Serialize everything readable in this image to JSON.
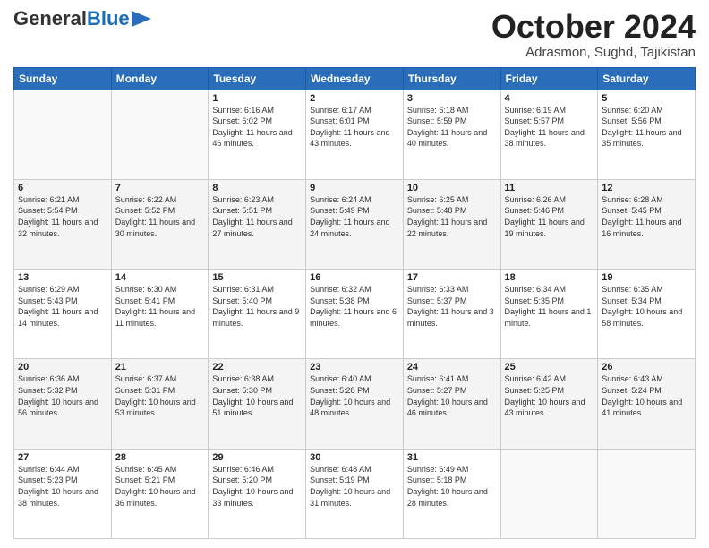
{
  "header": {
    "logo_general": "General",
    "logo_blue": "Blue",
    "month_title": "October 2024",
    "location": "Adrasmon, Sughd, Tajikistan"
  },
  "days_of_week": [
    "Sunday",
    "Monday",
    "Tuesday",
    "Wednesday",
    "Thursday",
    "Friday",
    "Saturday"
  ],
  "weeks": [
    [
      {
        "day": "",
        "sunrise": "",
        "sunset": "",
        "daylight": ""
      },
      {
        "day": "",
        "sunrise": "",
        "sunset": "",
        "daylight": ""
      },
      {
        "day": "1",
        "sunrise": "Sunrise: 6:16 AM",
        "sunset": "Sunset: 6:02 PM",
        "daylight": "Daylight: 11 hours and 46 minutes."
      },
      {
        "day": "2",
        "sunrise": "Sunrise: 6:17 AM",
        "sunset": "Sunset: 6:01 PM",
        "daylight": "Daylight: 11 hours and 43 minutes."
      },
      {
        "day": "3",
        "sunrise": "Sunrise: 6:18 AM",
        "sunset": "Sunset: 5:59 PM",
        "daylight": "Daylight: 11 hours and 40 minutes."
      },
      {
        "day": "4",
        "sunrise": "Sunrise: 6:19 AM",
        "sunset": "Sunset: 5:57 PM",
        "daylight": "Daylight: 11 hours and 38 minutes."
      },
      {
        "day": "5",
        "sunrise": "Sunrise: 6:20 AM",
        "sunset": "Sunset: 5:56 PM",
        "daylight": "Daylight: 11 hours and 35 minutes."
      }
    ],
    [
      {
        "day": "6",
        "sunrise": "Sunrise: 6:21 AM",
        "sunset": "Sunset: 5:54 PM",
        "daylight": "Daylight: 11 hours and 32 minutes."
      },
      {
        "day": "7",
        "sunrise": "Sunrise: 6:22 AM",
        "sunset": "Sunset: 5:52 PM",
        "daylight": "Daylight: 11 hours and 30 minutes."
      },
      {
        "day": "8",
        "sunrise": "Sunrise: 6:23 AM",
        "sunset": "Sunset: 5:51 PM",
        "daylight": "Daylight: 11 hours and 27 minutes."
      },
      {
        "day": "9",
        "sunrise": "Sunrise: 6:24 AM",
        "sunset": "Sunset: 5:49 PM",
        "daylight": "Daylight: 11 hours and 24 minutes."
      },
      {
        "day": "10",
        "sunrise": "Sunrise: 6:25 AM",
        "sunset": "Sunset: 5:48 PM",
        "daylight": "Daylight: 11 hours and 22 minutes."
      },
      {
        "day": "11",
        "sunrise": "Sunrise: 6:26 AM",
        "sunset": "Sunset: 5:46 PM",
        "daylight": "Daylight: 11 hours and 19 minutes."
      },
      {
        "day": "12",
        "sunrise": "Sunrise: 6:28 AM",
        "sunset": "Sunset: 5:45 PM",
        "daylight": "Daylight: 11 hours and 16 minutes."
      }
    ],
    [
      {
        "day": "13",
        "sunrise": "Sunrise: 6:29 AM",
        "sunset": "Sunset: 5:43 PM",
        "daylight": "Daylight: 11 hours and 14 minutes."
      },
      {
        "day": "14",
        "sunrise": "Sunrise: 6:30 AM",
        "sunset": "Sunset: 5:41 PM",
        "daylight": "Daylight: 11 hours and 11 minutes."
      },
      {
        "day": "15",
        "sunrise": "Sunrise: 6:31 AM",
        "sunset": "Sunset: 5:40 PM",
        "daylight": "Daylight: 11 hours and 9 minutes."
      },
      {
        "day": "16",
        "sunrise": "Sunrise: 6:32 AM",
        "sunset": "Sunset: 5:38 PM",
        "daylight": "Daylight: 11 hours and 6 minutes."
      },
      {
        "day": "17",
        "sunrise": "Sunrise: 6:33 AM",
        "sunset": "Sunset: 5:37 PM",
        "daylight": "Daylight: 11 hours and 3 minutes."
      },
      {
        "day": "18",
        "sunrise": "Sunrise: 6:34 AM",
        "sunset": "Sunset: 5:35 PM",
        "daylight": "Daylight: 11 hours and 1 minute."
      },
      {
        "day": "19",
        "sunrise": "Sunrise: 6:35 AM",
        "sunset": "Sunset: 5:34 PM",
        "daylight": "Daylight: 10 hours and 58 minutes."
      }
    ],
    [
      {
        "day": "20",
        "sunrise": "Sunrise: 6:36 AM",
        "sunset": "Sunset: 5:32 PM",
        "daylight": "Daylight: 10 hours and 56 minutes."
      },
      {
        "day": "21",
        "sunrise": "Sunrise: 6:37 AM",
        "sunset": "Sunset: 5:31 PM",
        "daylight": "Daylight: 10 hours and 53 minutes."
      },
      {
        "day": "22",
        "sunrise": "Sunrise: 6:38 AM",
        "sunset": "Sunset: 5:30 PM",
        "daylight": "Daylight: 10 hours and 51 minutes."
      },
      {
        "day": "23",
        "sunrise": "Sunrise: 6:40 AM",
        "sunset": "Sunset: 5:28 PM",
        "daylight": "Daylight: 10 hours and 48 minutes."
      },
      {
        "day": "24",
        "sunrise": "Sunrise: 6:41 AM",
        "sunset": "Sunset: 5:27 PM",
        "daylight": "Daylight: 10 hours and 46 minutes."
      },
      {
        "day": "25",
        "sunrise": "Sunrise: 6:42 AM",
        "sunset": "Sunset: 5:25 PM",
        "daylight": "Daylight: 10 hours and 43 minutes."
      },
      {
        "day": "26",
        "sunrise": "Sunrise: 6:43 AM",
        "sunset": "Sunset: 5:24 PM",
        "daylight": "Daylight: 10 hours and 41 minutes."
      }
    ],
    [
      {
        "day": "27",
        "sunrise": "Sunrise: 6:44 AM",
        "sunset": "Sunset: 5:23 PM",
        "daylight": "Daylight: 10 hours and 38 minutes."
      },
      {
        "day": "28",
        "sunrise": "Sunrise: 6:45 AM",
        "sunset": "Sunset: 5:21 PM",
        "daylight": "Daylight: 10 hours and 36 minutes."
      },
      {
        "day": "29",
        "sunrise": "Sunrise: 6:46 AM",
        "sunset": "Sunset: 5:20 PM",
        "daylight": "Daylight: 10 hours and 33 minutes."
      },
      {
        "day": "30",
        "sunrise": "Sunrise: 6:48 AM",
        "sunset": "Sunset: 5:19 PM",
        "daylight": "Daylight: 10 hours and 31 minutes."
      },
      {
        "day": "31",
        "sunrise": "Sunrise: 6:49 AM",
        "sunset": "Sunset: 5:18 PM",
        "daylight": "Daylight: 10 hours and 28 minutes."
      },
      {
        "day": "",
        "sunrise": "",
        "sunset": "",
        "daylight": ""
      },
      {
        "day": "",
        "sunrise": "",
        "sunset": "",
        "daylight": ""
      }
    ]
  ]
}
